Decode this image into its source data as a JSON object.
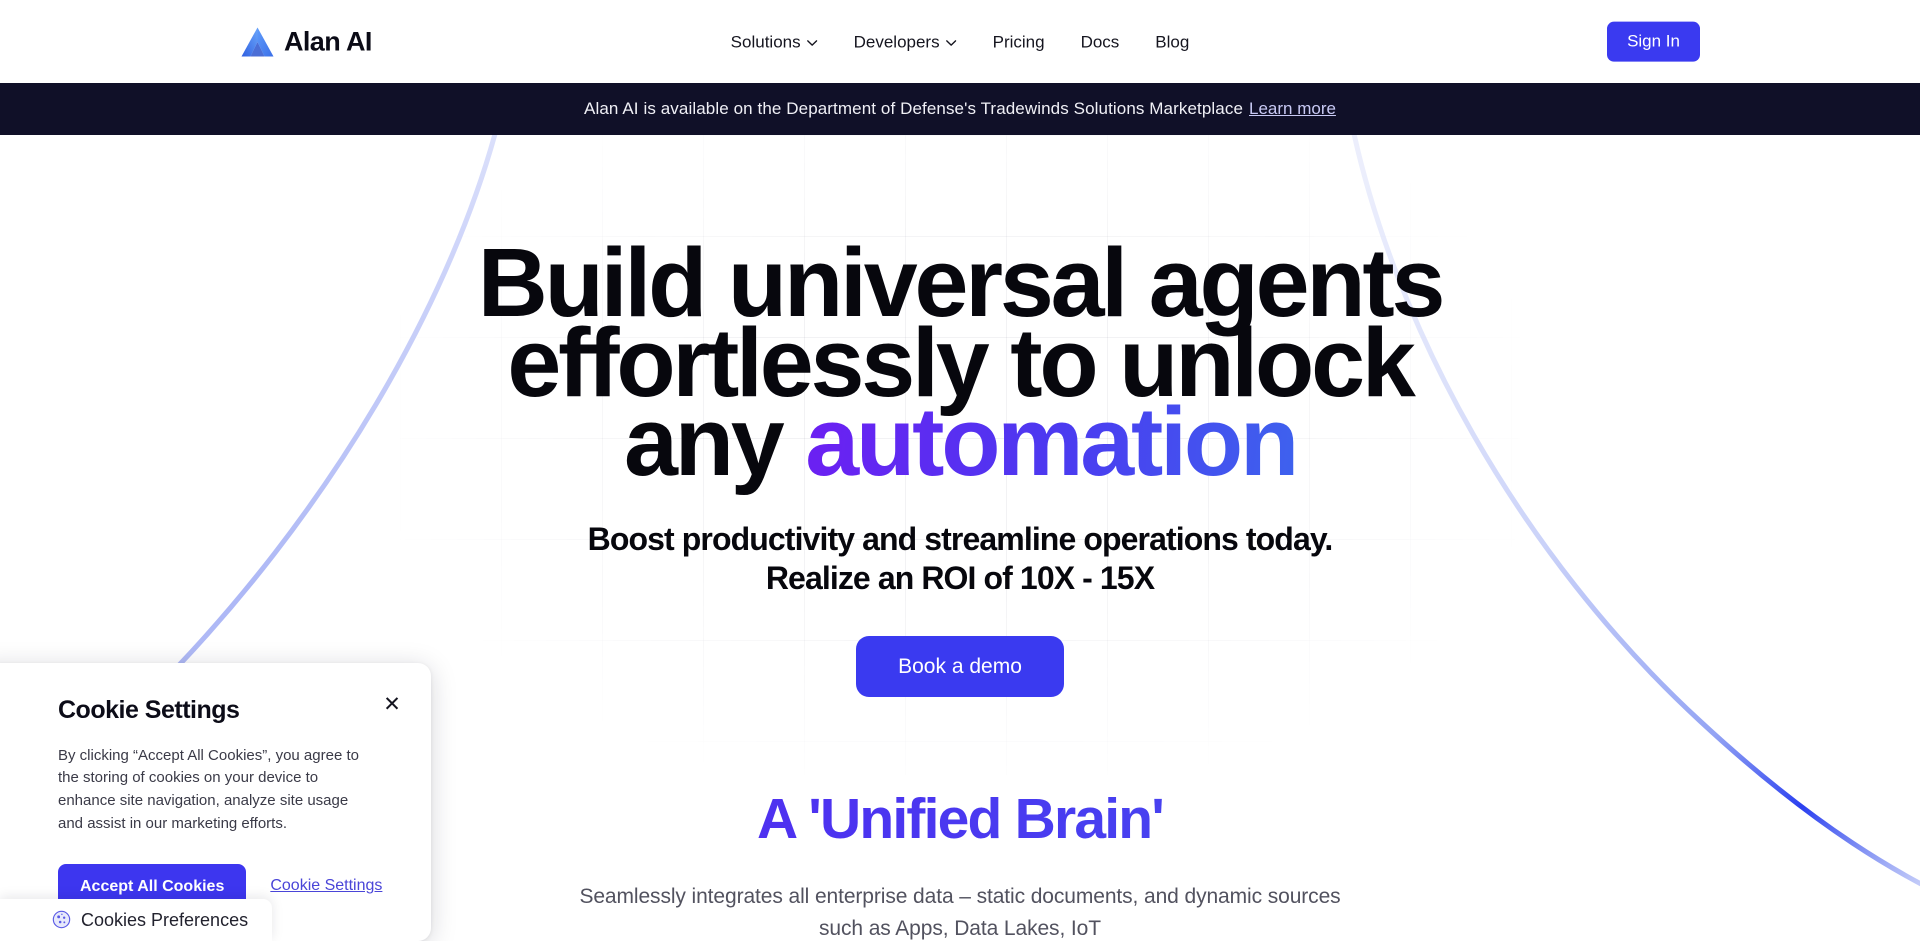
{
  "header": {
    "logo_text": "Alan AI",
    "nav": [
      {
        "label": "Solutions",
        "has_dropdown": true
      },
      {
        "label": "Developers",
        "has_dropdown": true
      },
      {
        "label": "Pricing",
        "has_dropdown": false
      },
      {
        "label": "Docs",
        "has_dropdown": false
      },
      {
        "label": "Blog",
        "has_dropdown": false
      }
    ],
    "sign_in_label": "Sign In"
  },
  "banner": {
    "text": "Alan AI is available on the Department of Defense's Tradewinds Solutions Marketplace",
    "link_label": "Learn more",
    "background": "#101028"
  },
  "hero": {
    "title_line1": "Build universal agents",
    "title_line2": "effortlessly to unlock",
    "title_line3_prefix": "any ",
    "title_line3_highlight": "automation",
    "subtitle_line1": "Boost productivity and streamline operations today.",
    "subtitle_line2": "Realize an ROI of 10X - 15X",
    "cta_label": "Book a demo"
  },
  "section2": {
    "title": "A 'Unified Brain'",
    "description_line1": "Seamlessly integrates all enterprise data – static documents, and dynamic sources",
    "description_line2": "such as Apps, Data Lakes, IoT"
  },
  "cookie_dialog": {
    "title": "Cookie Settings",
    "body": "By clicking “Accept All Cookies”, you agree to the storing of cookies on your device to enhance site navigation, analyze site usage and assist in our marketing efforts.",
    "accept_label": "Accept All Cookies",
    "settings_label": "Cookie Settings",
    "close_label": "✕"
  },
  "cookie_preferences": {
    "label": "Cookies Preferences"
  },
  "colors": {
    "accent_blue": "#3A3AF0",
    "gradient_start": "#6A21F2",
    "gradient_end": "#3E62EE",
    "banner_bg": "#101028",
    "text_dark": "#07070d"
  }
}
